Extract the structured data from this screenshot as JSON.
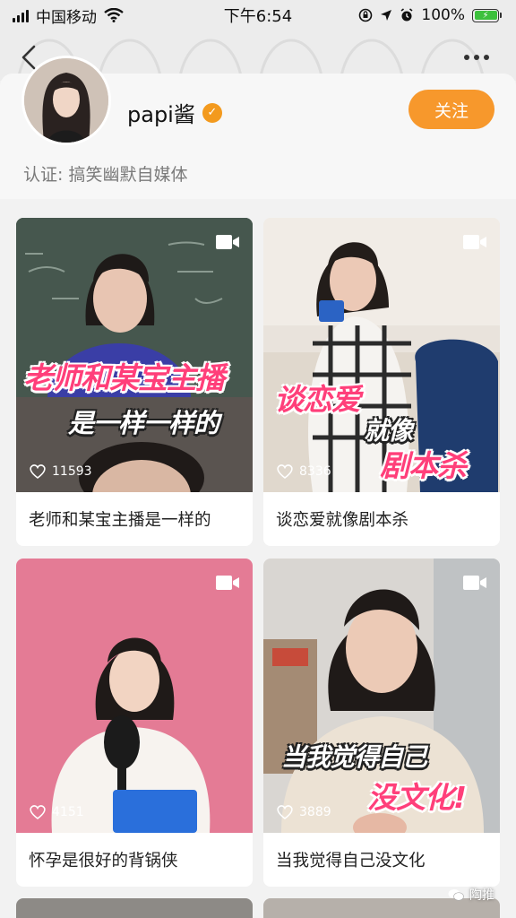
{
  "status_bar": {
    "carrier": "中国移动",
    "time": "下午6:54",
    "battery": "100%"
  },
  "profile": {
    "name": "papi酱",
    "follow_label": "关注",
    "verification": "认证: 搞笑幽默自媒体"
  },
  "videos": [
    {
      "title": "老师和某宝主播是一样的",
      "likes": "11593",
      "overlay_line1": "老师和某宝主播",
      "overlay_line2": "是一样一样的"
    },
    {
      "title": "谈恋爱就像剧本杀",
      "likes": "8336",
      "overlay_line1": "谈恋爱",
      "overlay_line2": "就像",
      "overlay_line3": "剧本杀"
    },
    {
      "title": "怀孕是很好的背锅侠",
      "likes": "4151"
    },
    {
      "title": "当我觉得自己没文化",
      "likes": "3889",
      "overlay_line1": "当我觉得自己",
      "overlay_line2": "没文化!"
    }
  ],
  "watermark": "陶推",
  "colors": {
    "accent": "#f7982c",
    "verify_badge": "#f39a1e",
    "overlay_pink": "#ff3f7a"
  }
}
